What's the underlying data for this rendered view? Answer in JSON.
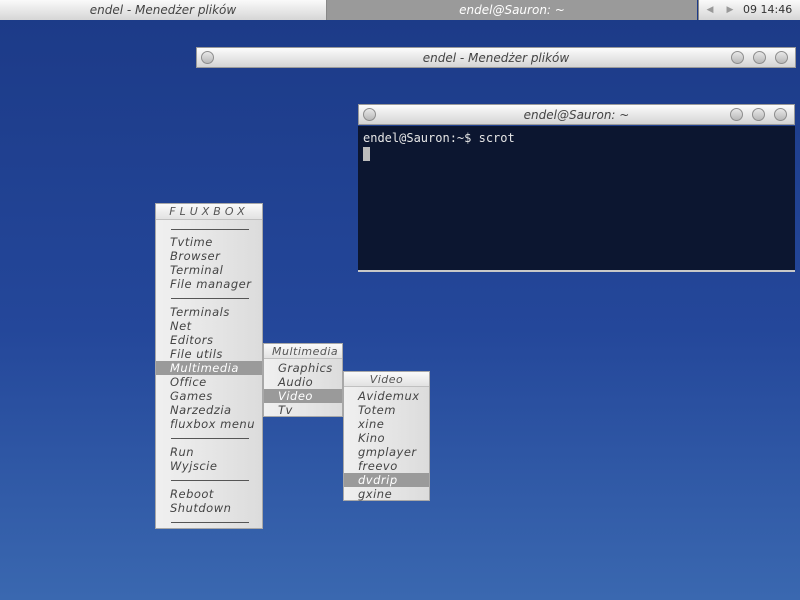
{
  "toolbar": {
    "task_1": "endel - Menedżer plików",
    "task_2": "endel@Sauron: ~",
    "prev_icon": "◀",
    "next_icon": "▶",
    "clock": "09 14:46"
  },
  "windows": {
    "file_manager": {
      "title": "endel - Menedżer plików"
    },
    "terminal": {
      "title": "endel@Sauron: ~",
      "line": "endel@Sauron:~$ scrot"
    }
  },
  "menus": {
    "root": {
      "title": "FLUXBOX",
      "items": [
        "Tvtime",
        "Browser",
        "Terminal",
        "File manager",
        "Terminals",
        "Net",
        "Editors",
        "File utils",
        "Multimedia",
        "Office",
        "Games",
        "Narzedzia",
        "fluxbox menu",
        "Run",
        "Wyjscie",
        "Reboot",
        "Shutdown"
      ],
      "selected": "Multimedia"
    },
    "multimedia": {
      "title": "Multimedia",
      "items": [
        "Graphics",
        "Audio",
        "Video",
        "Tv"
      ],
      "selected": "Video"
    },
    "video": {
      "title": "Video",
      "items": [
        "Avidemux",
        "Totem",
        "xine",
        "Kino",
        "gmplayer",
        "freevo",
        "dvdrip",
        "gxine"
      ],
      "selected": "dvdrip"
    }
  },
  "colors": {
    "desktop_top": "#1c3a87",
    "desktop_bottom": "#3a68b0",
    "terminal_bg": "#0c1630",
    "menu_highlight": "#9a9a9a"
  }
}
